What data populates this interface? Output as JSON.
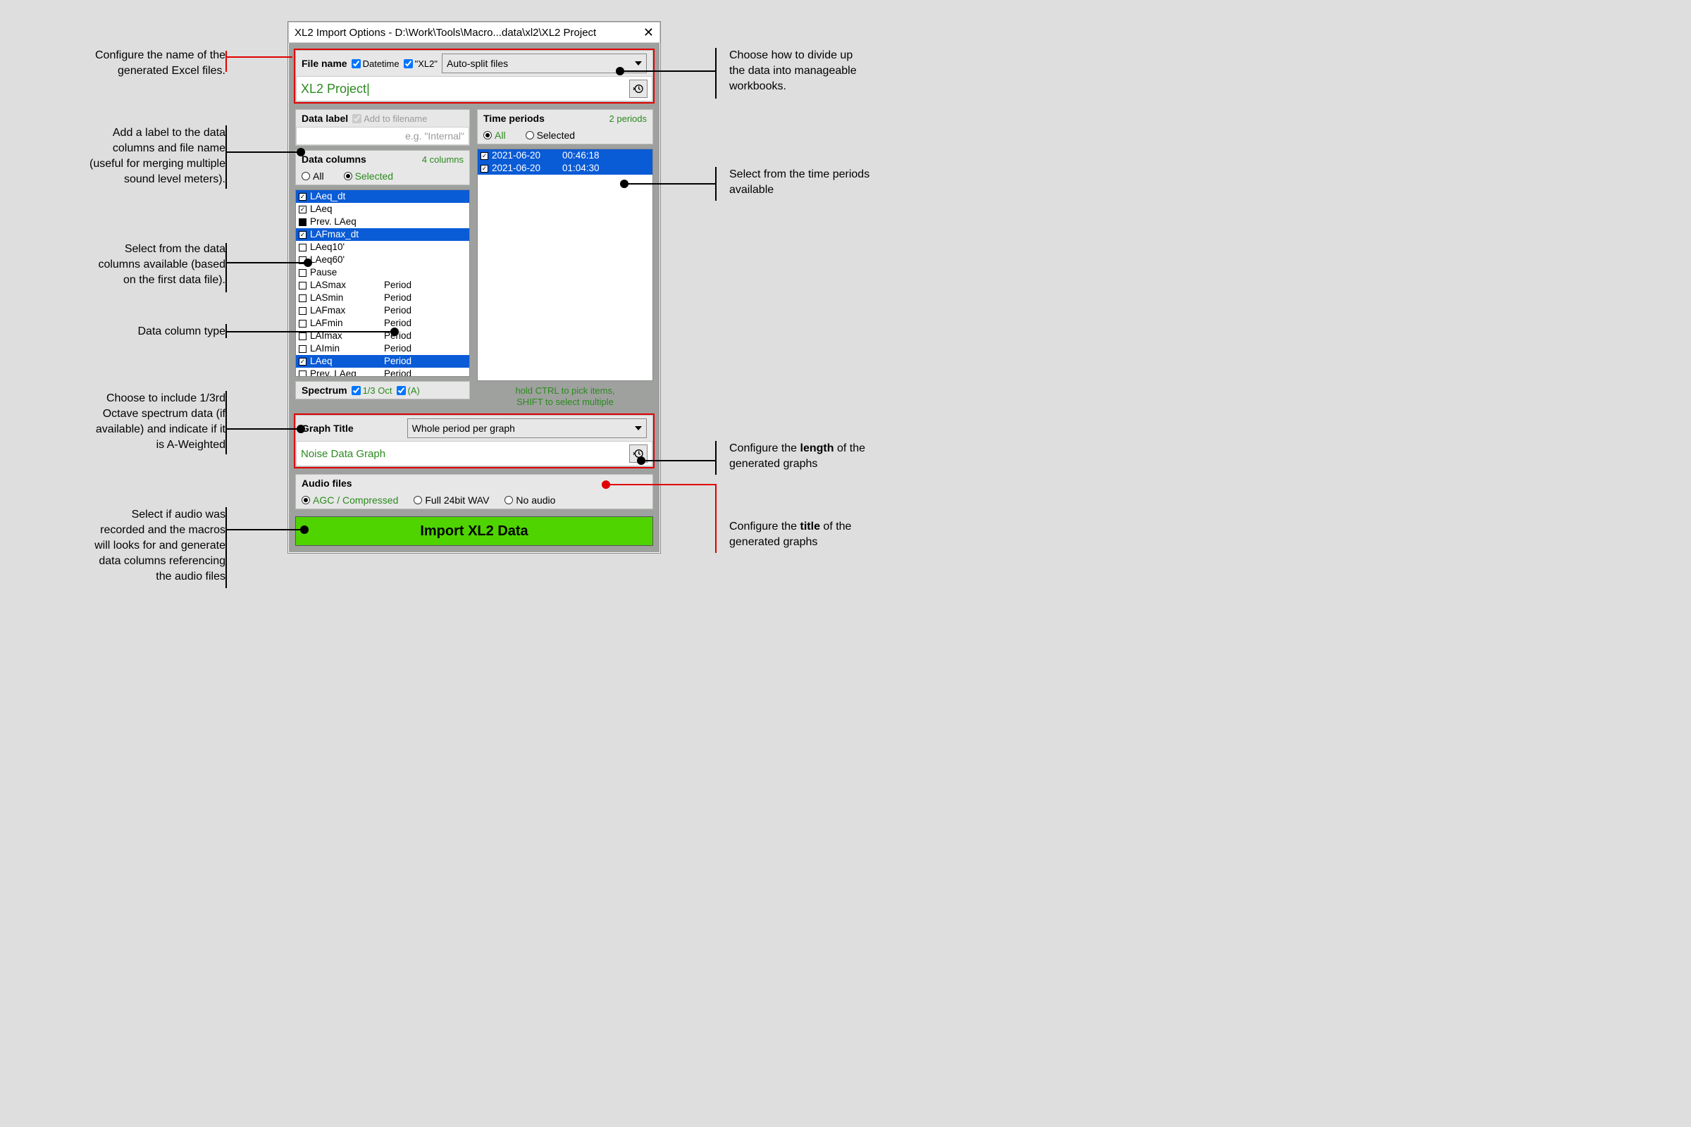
{
  "window": {
    "title": "XL2 Import Options - D:\\Work\\Tools\\Macro...data\\xl2\\XL2 Project",
    "close": "✕"
  },
  "filename": {
    "label": "File name",
    "cb_dt": "Datetime",
    "cb_xl2": "\"XL2\"",
    "split": "Auto-split files",
    "value": "XL2 Project"
  },
  "datalabel": {
    "label": "Data label",
    "cb": "Add to filename",
    "ph": "e.g. \"Internal\""
  },
  "datacols": {
    "label": "Data columns",
    "count": "4 columns",
    "all": "All",
    "sel": "Selected",
    "items": [
      {
        "n": "LAeq_dt",
        "c": true,
        "s": true
      },
      {
        "n": "LAeq",
        "c": true,
        "s": false
      },
      {
        "n": "Prev. LAeq",
        "c": true,
        "s": false,
        "dark": true
      },
      {
        "n": "LAFmax_dt",
        "c": true,
        "s": true
      },
      {
        "n": "LAeq10'",
        "c": false,
        "s": false
      },
      {
        "n": "LAeq60'",
        "c": false,
        "s": false
      },
      {
        "n": "Pause",
        "c": false,
        "s": false
      },
      {
        "n": "LASmax",
        "c": false,
        "s": false,
        "t": "Period"
      },
      {
        "n": "LASmin",
        "c": false,
        "s": false,
        "t": "Period"
      },
      {
        "n": "LAFmax",
        "c": false,
        "s": false,
        "t": "Period"
      },
      {
        "n": "LAFmin",
        "c": false,
        "s": false,
        "t": "Period"
      },
      {
        "n": "LAImax",
        "c": false,
        "s": false,
        "t": "Period"
      },
      {
        "n": "LAImin",
        "c": false,
        "s": false,
        "t": "Period"
      },
      {
        "n": "LAeq",
        "c": true,
        "s": true,
        "t": "Period"
      },
      {
        "n": "Prev. LAeq",
        "c": false,
        "s": false,
        "t": "Period"
      }
    ]
  },
  "spectrum": {
    "label": "Spectrum",
    "oct": "1/3 Oct",
    "wt": "(A)"
  },
  "periods": {
    "label": "Time periods",
    "count": "2 periods",
    "all": "All",
    "sel": "Selected",
    "items": [
      {
        "d": "2021-06-20",
        "t": "00:46:18"
      },
      {
        "d": "2021-06-20",
        "t": "01:04:30"
      }
    ]
  },
  "hint": "hold CTRL to pick items,\nSHIFT to select multiple",
  "graph": {
    "label": "Graph Title",
    "len": "Whole period per graph",
    "value": "Noise Data Graph"
  },
  "audio": {
    "label": "Audio files",
    "o1": "AGC / Compressed",
    "o2": "Full 24bit WAV",
    "o3": "No audio"
  },
  "import": "Import XL2 Data",
  "callouts": {
    "c1": "Configure the name of the\ngenerated Excel files.",
    "c2": "Choose how to divide up\nthe data into manageable\nworkbooks.",
    "c3": "Add a label to the data\ncolumns and file name\n(useful for merging multiple\nsound level meters).",
    "c4": "Select from the time periods\navailable",
    "c5": "Select from the data\ncolumns available (based\non the first data file).",
    "c6": "Data column type",
    "c7": "Choose to include 1/3rd\nOctave spectrum data (if\navailable) and indicate if it\nis A-Weighted",
    "c8a": "Configure the ",
    "c8b": "length",
    "c8c": " of the\ngenerated graphs",
    "c9a": "Configure the ",
    "c9b": "title",
    "c9c": " of the\ngenerated graphs",
    "c10": "Select if audio was\nrecorded and the macros\nwill looks for and generate\ndata columns referencing\nthe audio files"
  }
}
